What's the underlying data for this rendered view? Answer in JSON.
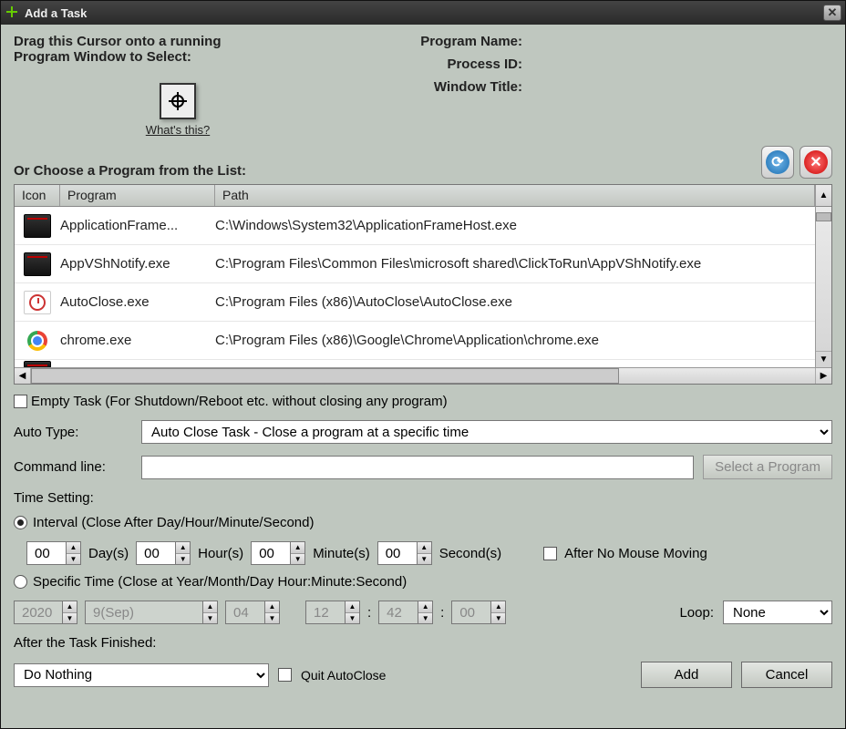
{
  "title": "Add a Task",
  "drag_instruction": "Drag this Cursor onto a running Program Window to Select:",
  "whats_this": "What's this?",
  "info_labels": {
    "name": "Program Name:",
    "pid": "Process ID:",
    "title": "Window Title:"
  },
  "choose_label": "Or Choose a Program from the List:",
  "columns": {
    "icon": "Icon",
    "program": "Program",
    "path": "Path"
  },
  "programs": [
    {
      "icon": "dark",
      "name": "ApplicationFrame...",
      "path": "C:\\Windows\\System32\\ApplicationFrameHost.exe"
    },
    {
      "icon": "dark",
      "name": "AppVShNotify.exe",
      "path": "C:\\Program Files\\Common Files\\microsoft shared\\ClickToRun\\AppVShNotify.exe"
    },
    {
      "icon": "clock",
      "name": "AutoClose.exe",
      "path": "C:\\Program Files (x86)\\AutoClose\\AutoClose.exe"
    },
    {
      "icon": "chrome",
      "name": "chrome.exe",
      "path": "C:\\Program Files (x86)\\Google\\Chrome\\Application\\chrome.exe"
    }
  ],
  "empty_task": "Empty Task (For Shutdown/Reboot etc. without closing any program)",
  "auto_type_label": "Auto Type:",
  "auto_type_value": "Auto Close Task - Close a program at a specific time",
  "command_line_label": "Command line:",
  "select_program_btn": "Select a Program",
  "time_setting_label": "Time Setting:",
  "interval_label": "Interval (Close After Day/Hour/Minute/Second)",
  "interval": {
    "day": "00",
    "hour": "00",
    "minute": "00",
    "second": "00"
  },
  "units": {
    "day": "Day(s)",
    "hour": "Hour(s)",
    "minute": "Minute(s)",
    "second": "Second(s)"
  },
  "after_no_mouse": "After No Mouse Moving",
  "specific_label": "Specific Time (Close at Year/Month/Day Hour:Minute:Second)",
  "specific": {
    "year": "2020",
    "month": "9(Sep)",
    "day": "04",
    "hour": "12",
    "minute": "42",
    "second": "00"
  },
  "loop_label": "Loop:",
  "loop_value": "None",
  "after_finished_label": "After the Task Finished:",
  "after_finished_value": "Do Nothing",
  "quit_autoclose": "Quit AutoClose",
  "add_btn": "Add",
  "cancel_btn": "Cancel"
}
